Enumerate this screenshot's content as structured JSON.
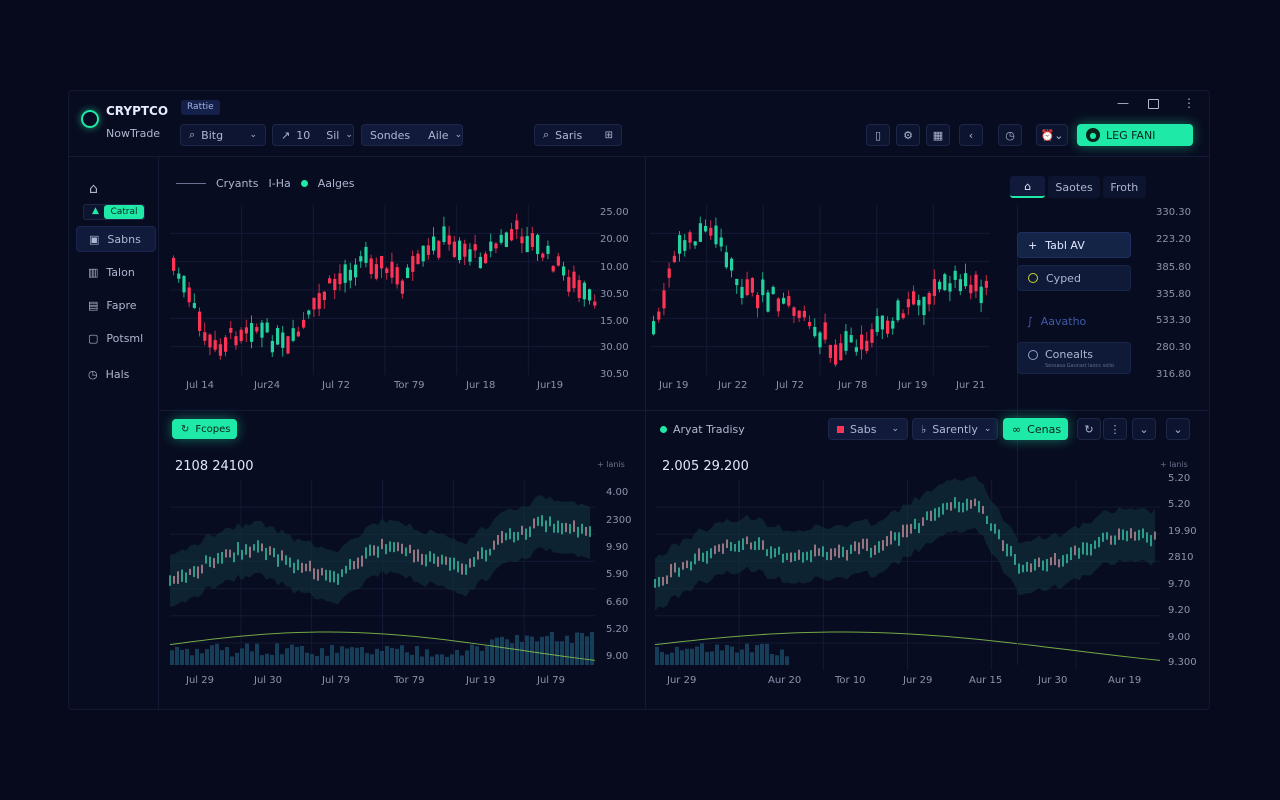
{
  "app": {
    "brand": "CRYPTCO",
    "subtitle": "NowTrade",
    "tag": "Rattie"
  },
  "toolbar": {
    "symbol": "Bitg",
    "interval": "10",
    "mode": "Sil",
    "studies": "Sondes",
    "alerts": "Aile",
    "search": "Saris",
    "account_label": "LEG FANI"
  },
  "sidebar": {
    "items": [
      {
        "label": "",
        "icon": "home-icon"
      },
      {
        "label": "Catral",
        "icon": "chip-icon"
      },
      {
        "label": "Sabns",
        "icon": "wallet-icon"
      },
      {
        "label": "Talon",
        "icon": "chart-icon"
      },
      {
        "label": "Fapre",
        "icon": "folder-icon"
      },
      {
        "label": "Potsml",
        "icon": "document-icon"
      },
      {
        "label": "Hals",
        "icon": "clock-icon"
      }
    ]
  },
  "top_left_chart": {
    "legend": [
      "Cryants",
      "I-Ha",
      "Aalges"
    ],
    "x_ticks": [
      "Jul 14",
      "Jur24",
      "Jul 72",
      "Tor 79",
      "Jur 18",
      "Jur19"
    ],
    "y_ticks": [
      "25.00",
      "20.00",
      "10.00",
      "30.50",
      "15.00",
      "30.00",
      "30.50"
    ]
  },
  "top_right_chart": {
    "x_ticks": [
      "Jur 19",
      "Jur 22",
      "Jul 72",
      "Jur 78",
      "Jur 19",
      "Jur 21"
    ],
    "y_ticks": [
      "330.30",
      "223.20",
      "385.80",
      "335.80",
      "533.30",
      "280.30",
      "316.80"
    ]
  },
  "right_panel": {
    "tabs": [
      "",
      "Saotes",
      "Froth"
    ],
    "items": [
      "Tabl AV",
      "Cyped",
      "Aavatho",
      "Conealts"
    ],
    "sub": "Sessasa Gaurast laocs solio"
  },
  "bottom_left_chart": {
    "button": "Fcopes",
    "value": "2108 24100",
    "corner": "+ lanis",
    "x_ticks": [
      "Jul 29",
      "Jul 30",
      "Jul 79",
      "Tor 79",
      "Jur 19",
      "Jul 79"
    ],
    "y_ticks": [
      "4.00",
      "2300",
      "9.90",
      "5.90",
      "6.60",
      "5.20",
      "9.00"
    ]
  },
  "bottom_right_chart": {
    "legend": "Aryat Tradisy",
    "controls": [
      "Sabs",
      "Sarently",
      "Cenas"
    ],
    "value": "2.005 29.200",
    "corner": "+ lanis",
    "x_ticks": [
      "Jur 29",
      "Aur 20",
      "Tor 10",
      "Jur 29",
      "Aur 15",
      "Jur 30",
      "Aur 19"
    ],
    "y_ticks": [
      "5.20",
      "5.20",
      "19.90",
      "2810",
      "9.70",
      "9.20",
      "9.00",
      "9.300"
    ]
  },
  "colors": {
    "accent": "#1fe9a6",
    "up": "#22d3a0",
    "down": "#ff3355",
    "bg": "#070a1c"
  }
}
